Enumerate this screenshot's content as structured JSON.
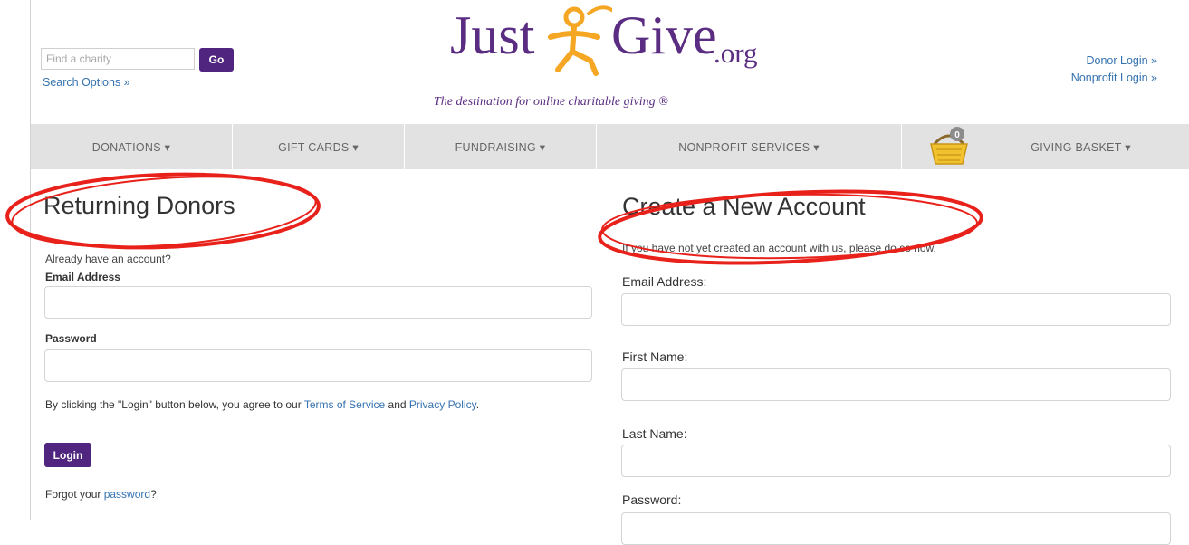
{
  "header": {
    "search": {
      "placeholder": "Find a charity",
      "go_label": "Go",
      "options_label": "Search Options »"
    },
    "logo": {
      "word1": "Just",
      "word2": "Give",
      "tld": ".org",
      "tagline": "The destination for online charitable giving ®"
    },
    "donor_login": "Donor Login »",
    "nonprofit_login": "Nonprofit Login »",
    "colors": {
      "brand": "#5a2d82",
      "accent": "#f5a623",
      "link": "#3572b0",
      "button": "#4f2580"
    }
  },
  "nav": {
    "items": [
      {
        "label": "DONATIONS ▾"
      },
      {
        "label": "GIFT CARDS ▾"
      },
      {
        "label": "FUNDRAISING ▾"
      },
      {
        "label": "NONPROFIT SERVICES ▾"
      },
      {
        "label": "GIVING BASKET ▾"
      }
    ],
    "basket_count": "0",
    "basket_icon": "basket-icon"
  },
  "returning": {
    "title": "Returning Donors",
    "subtitle": "Already have an account?",
    "email_label": "Email Address",
    "password_label": "Password",
    "agree_prefix": "By clicking the \"Login\" button below, you agree to our ",
    "terms_link": "Terms of Service",
    "agree_and": " and ",
    "privacy_link": "Privacy Policy",
    "agree_suffix": ".",
    "login_label": "Login",
    "forgot_prefix": "Forgot your ",
    "forgot_link": "password",
    "forgot_suffix": "?"
  },
  "create": {
    "title": "Create a New Account",
    "subtitle": "If you have not yet created an account with us, please do so now.",
    "email_label": "Email Address:",
    "first_label": "First Name:",
    "last_label": "Last Name:",
    "password_label": "Password:"
  },
  "annotation_color": "#e8221b"
}
